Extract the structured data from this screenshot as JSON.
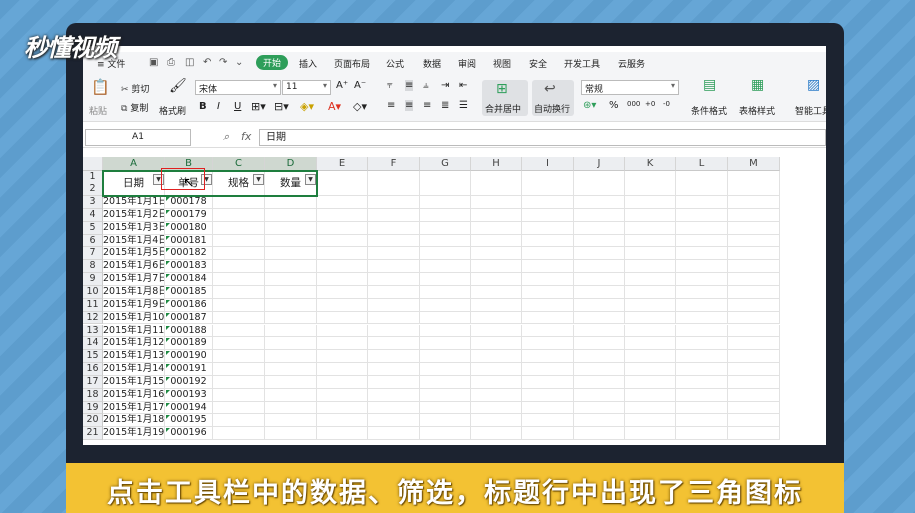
{
  "logo": "秒懂视频",
  "caption": "点击工具栏中的数据、筛选，标题行中出现了三角图标",
  "menu": {
    "file": "≡ 文件",
    "tabs": [
      "开始",
      "插入",
      "页面布局",
      "公式",
      "数据",
      "审阅",
      "视图",
      "安全",
      "开发工具",
      "云服务"
    ],
    "active_tab": "开始"
  },
  "ribbon": {
    "paste": "粘贴",
    "cut": "剪切",
    "copy": "复制",
    "format_painter": "格式刷",
    "font_name": "宋体",
    "font_size": "11",
    "merge_center": "合并居中",
    "wrap_text": "自动换行",
    "number_format": "常规",
    "conditional_format": "条件格式",
    "table_style": "表格样式",
    "smart_tools": "智能工具"
  },
  "formula_bar": {
    "name_box": "A1",
    "fx": "fx",
    "content": "日期"
  },
  "columns": [
    "A",
    "B",
    "C",
    "D",
    "E",
    "F",
    "G",
    "H",
    "I",
    "J",
    "K",
    "L",
    "M"
  ],
  "headers": [
    "日期",
    "单号",
    "规格",
    "数量"
  ],
  "rows": [
    {
      "n": "3",
      "date": "2015年1月1日",
      "no": "000178"
    },
    {
      "n": "4",
      "date": "2015年1月2日",
      "no": "000179"
    },
    {
      "n": "5",
      "date": "2015年1月3日",
      "no": "000180"
    },
    {
      "n": "6",
      "date": "2015年1月4日",
      "no": "000181"
    },
    {
      "n": "7",
      "date": "2015年1月5日",
      "no": "000182"
    },
    {
      "n": "8",
      "date": "2015年1月6日",
      "no": "000183"
    },
    {
      "n": "9",
      "date": "2015年1月7日",
      "no": "000184"
    },
    {
      "n": "10",
      "date": "2015年1月8日",
      "no": "000185"
    },
    {
      "n": "11",
      "date": "2015年1月9日",
      "no": "000186"
    },
    {
      "n": "12",
      "date": "2015年1月10日",
      "no": "000187"
    },
    {
      "n": "13",
      "date": "2015年1月11日",
      "no": "000188"
    },
    {
      "n": "14",
      "date": "2015年1月12日",
      "no": "000189"
    },
    {
      "n": "15",
      "date": "2015年1月13日",
      "no": "000190"
    },
    {
      "n": "16",
      "date": "2015年1月14日",
      "no": "000191"
    },
    {
      "n": "17",
      "date": "2015年1月15日",
      "no": "000192"
    },
    {
      "n": "18",
      "date": "2015年1月16日",
      "no": "000193"
    },
    {
      "n": "19",
      "date": "2015年1月17日",
      "no": "000194"
    },
    {
      "n": "20",
      "date": "2015年1月18日",
      "no": "000195"
    },
    {
      "n": "21",
      "date": "2015年1月19日",
      "no": "000196"
    }
  ]
}
